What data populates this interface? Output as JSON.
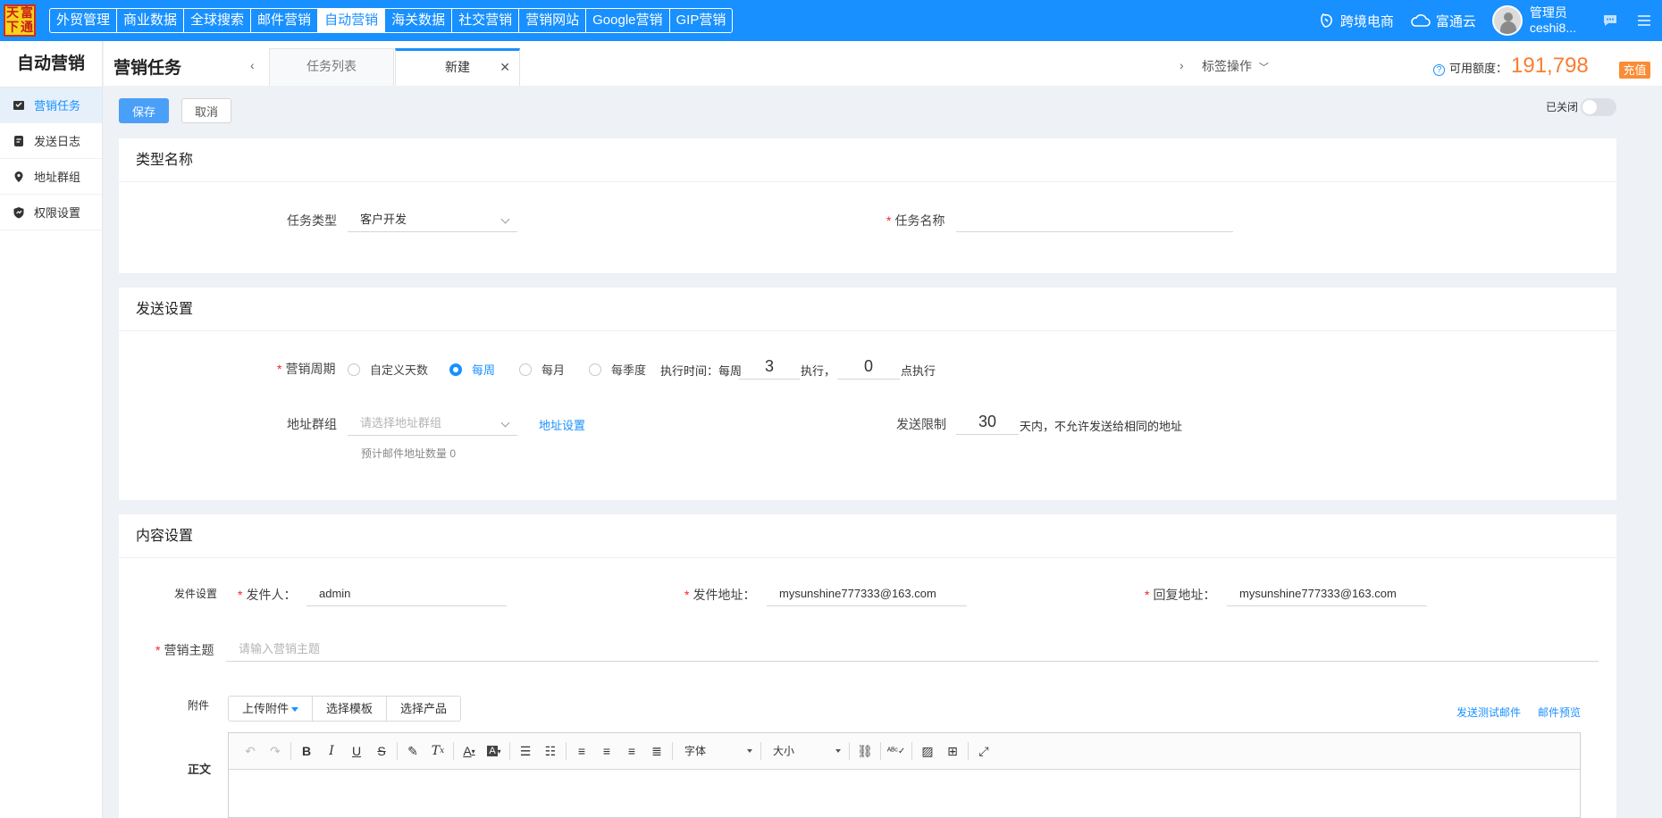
{
  "app": {
    "logo_chars": [
      "天",
      "富",
      "下",
      "通"
    ],
    "nav": [
      "外贸管理",
      "商业数据",
      "全球搜索",
      "邮件营销",
      "自动营销",
      "海关数据",
      "社交营销",
      "营销网站",
      "Google营销",
      "GIP营销"
    ],
    "active_nav_index": 4,
    "top_links": {
      "ecommerce": "跨境电商",
      "cloud": "富通云"
    },
    "user": {
      "role": "管理员",
      "name": "ceshi8..."
    }
  },
  "sidebar": {
    "title": "自动营销",
    "items": [
      {
        "label": "营销任务",
        "icon": "task-icon",
        "active": true
      },
      {
        "label": "发送日志",
        "icon": "log-icon",
        "active": false
      },
      {
        "label": "地址群组",
        "icon": "location-icon",
        "active": false
      },
      {
        "label": "权限设置",
        "icon": "permission-icon",
        "active": false
      }
    ]
  },
  "header": {
    "title": "营销任务",
    "tabs": [
      {
        "label": "任务列表",
        "active": false
      },
      {
        "label": "新建",
        "active": true
      }
    ],
    "tag_ops": "标签操作",
    "credit_label": "可用额度：",
    "credit_amount": "191,798",
    "recharge": "充值"
  },
  "actions": {
    "save": "保存",
    "cancel": "取消",
    "status_label": "已关闭",
    "enabled": false
  },
  "type_section": {
    "title": "类型名称",
    "task_type_label": "任务类型",
    "task_type_value": "客户开发",
    "task_name_label": "任务名称",
    "task_name_value": ""
  },
  "send_section": {
    "title": "发送设置",
    "cycle_label": "营销周期",
    "cycle_options": [
      "自定义天数",
      "每周",
      "每月",
      "每季度"
    ],
    "cycle_selected": "每周",
    "exec_time_label": "执行时间：每周",
    "exec_day": "3",
    "exec_mid": "执行，",
    "exec_hour": "0",
    "exec_suffix": "点执行",
    "group_label": "地址群组",
    "group_placeholder": "请选择地址群组",
    "group_link": "地址设置",
    "estimate": "预计邮件地址数量 0",
    "limit_label": "发送限制",
    "limit_value": "30",
    "limit_suffix": "天内，不允许发送给相同的地址"
  },
  "content_section": {
    "title": "内容设置",
    "sender_settings": "发件设置",
    "sender_label": "发件人：",
    "sender_value": "admin",
    "from_label": "发件地址：",
    "from_value": "mysunshine777333@163.com",
    "reply_label": "回复地址：",
    "reply_value": "mysunshine777333@163.com",
    "subject_label": "营销主题",
    "subject_placeholder": "请输入营销主题",
    "attachment_label": "附件",
    "upload_btn": "上传附件",
    "template_btn": "选择模板",
    "product_btn": "选择产品",
    "send_test": "发送测试邮件",
    "preview": "邮件预览",
    "body_label": "正文",
    "font_select": "字体",
    "size_select": "大小"
  },
  "colors": {
    "primary": "#1890ff",
    "accent": "#fa7d2f",
    "required": "#f5222d"
  }
}
